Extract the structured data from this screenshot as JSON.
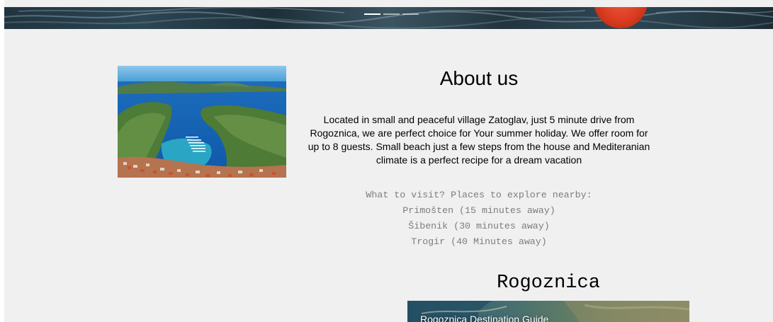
{
  "hero": {
    "slide_indicators": [
      "slide-1",
      "slide-2",
      "slide-3"
    ],
    "active_slide": 1
  },
  "about": {
    "title": "About us",
    "description_lines": [
      "Located in small and peaceful village Zatoglav, just 5 minute drive from",
      "Rogoznica, we are perfect choice for Your summer holiday. We offer room for",
      "up to 8 guests. Small beach just a few steps from the house and Mediteranian",
      "climate is a perfect recipe for a dream vacation"
    ],
    "explore_heading": "What to visit? Places to explore nearby:",
    "places": [
      "Primošten (15 minutes away)",
      "Šibenik (30 minutes away)",
      "Trogir (40 Minutes away)"
    ]
  },
  "destination": {
    "title": "Rogoznica",
    "video_title": "Rogoznica Destination Guide"
  },
  "colors": {
    "page_background": "#f0f0f0",
    "muted_text": "#7d7d7d",
    "buoy": "#d93b20"
  }
}
